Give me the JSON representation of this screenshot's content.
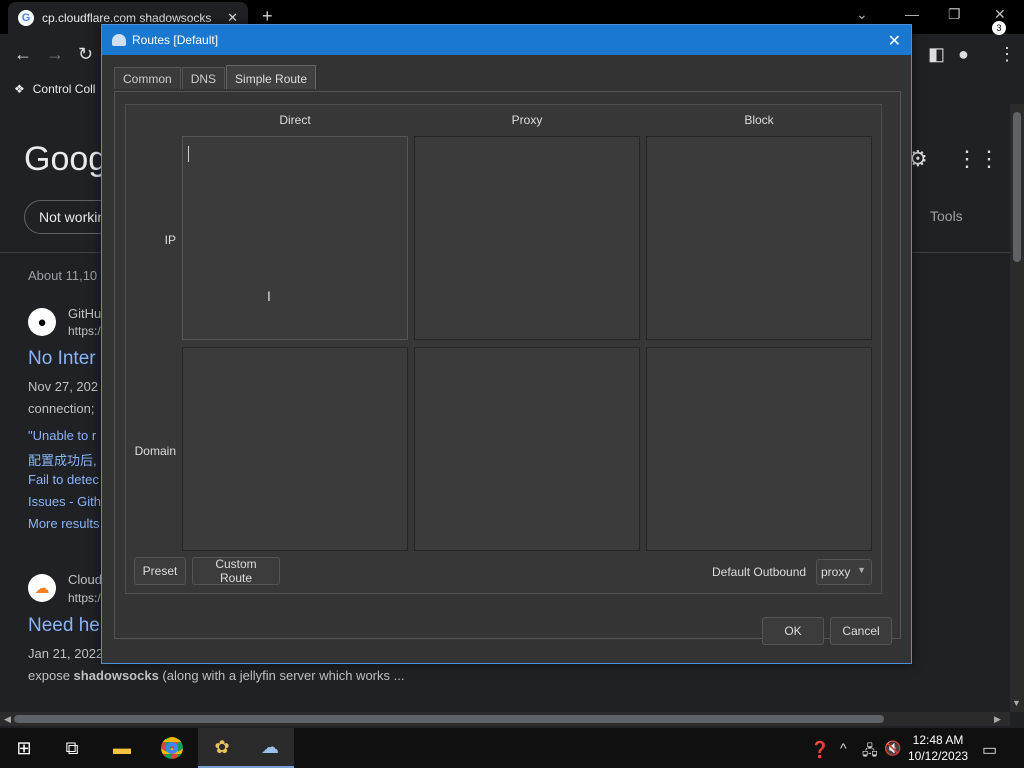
{
  "browser": {
    "tab_title": "cp.cloudflare.com shadowsocks",
    "tab_favicon": "G",
    "bookmark": "Control Coll",
    "google_logo": "Googl",
    "search_chip": "Not workin",
    "tools": "Tools",
    "about": "About 11,10",
    "results": [
      {
        "favicon": "github-icon",
        "site": "GitHu",
        "url": "https:/",
        "title": "No Inter",
        "date": "Nov 27, 202",
        "snippet": "connection;"
      },
      {
        "favicon": "cloudflare-icon",
        "site": "Cloud",
        "url": "https:/",
        "title": "Need he",
        "date": "Jan 21, 2022",
        "snippet_prefix": "expose ",
        "snippet_bold": "shadowsocks",
        "snippet_rest": " (along with a jellyfin server which works ..."
      }
    ],
    "more_links": [
      "\"Unable to r",
      "配置成功后,",
      "Fail to detec",
      "Issues - Gith",
      "More results"
    ]
  },
  "dialog": {
    "title": "Routes [Default]",
    "tabs": [
      "Common",
      "DNS",
      "Simple Route"
    ],
    "selected_tab": "Simple Route",
    "columns": [
      "Direct",
      "Proxy",
      "Block"
    ],
    "rows": [
      "IP",
      "Domain"
    ],
    "preset_label": "Preset",
    "custom_route_label": "Custom Route",
    "default_outbound_label": "Default Outbound",
    "default_outbound_value": "proxy",
    "ok_label": "OK",
    "cancel_label": "Cancel"
  },
  "taskbar": {
    "time": "12:48 AM",
    "date": "10/12/2023",
    "notification_count": "3"
  },
  "colors": {
    "titlebar": "#1b78d0",
    "dialog_bg": "#333333",
    "link": "#8ab4f8"
  }
}
